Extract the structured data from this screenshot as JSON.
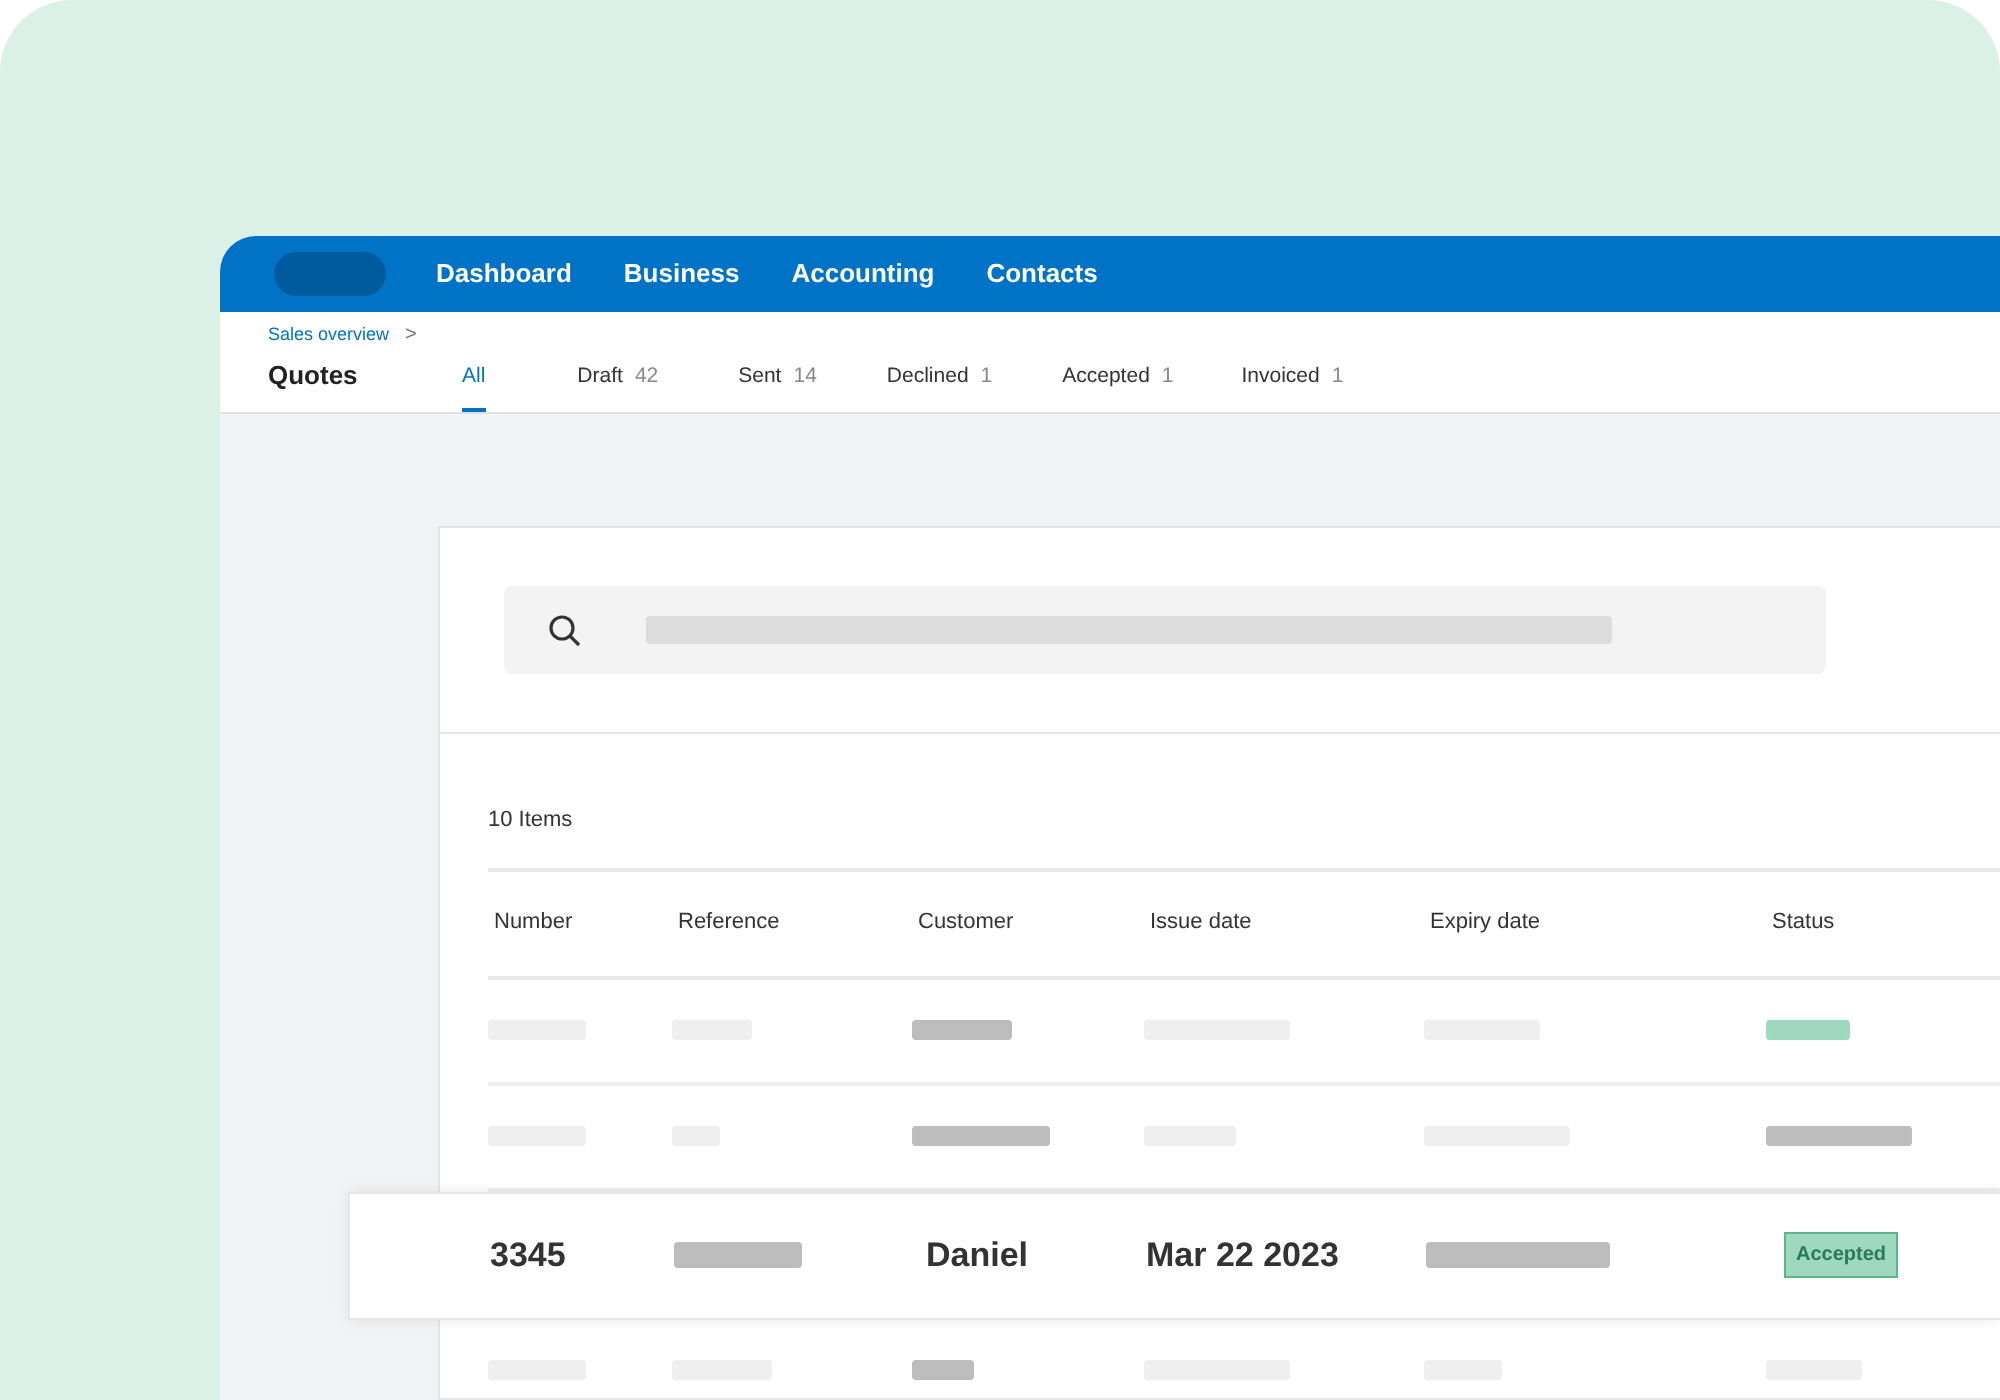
{
  "nav": {
    "items": [
      {
        "label": "Dashboard"
      },
      {
        "label": "Business"
      },
      {
        "label": "Accounting"
      },
      {
        "label": "Contacts"
      }
    ]
  },
  "header": {
    "breadcrumb": "Sales overview",
    "chevron": ">",
    "title": "Quotes"
  },
  "tabs": [
    {
      "label": "All",
      "selected": true
    },
    {
      "label": "Draft",
      "count": "42",
      "selected": false
    },
    {
      "label": "Sent",
      "count": "14",
      "selected": false
    },
    {
      "label": "Declined",
      "count": "1",
      "selected": false
    },
    {
      "label": "Accepted",
      "count": "1",
      "selected": false
    },
    {
      "label": "Invoiced",
      "count": "1",
      "selected": false
    }
  ],
  "item_count": "10 Items",
  "table": {
    "columns": [
      "Number",
      "Reference",
      "Customer",
      "Issue date",
      "Expiry date",
      "Status"
    ],
    "rows": [
      {
        "kind": "skeleton",
        "cells": [
          {
            "kind": "light"
          },
          {
            "kind": "light"
          },
          {
            "kind": "dark"
          },
          {
            "kind": "light"
          },
          {
            "kind": "light"
          },
          {
            "kind": "accent"
          }
        ]
      },
      {
        "kind": "skeleton",
        "cells": [
          {
            "kind": "light"
          },
          {
            "kind": "light"
          },
          {
            "kind": "dark"
          },
          {
            "kind": "light"
          },
          {
            "kind": "light"
          },
          {
            "kind": "dark"
          }
        ]
      },
      {
        "kind": "highlight",
        "number": "3345",
        "customer": "Daniel",
        "issue_date": "Mar 22 2023",
        "status": "Accepted"
      },
      {
        "kind": "skeleton",
        "cells": [
          {
            "kind": "light"
          },
          {
            "kind": "light"
          },
          {
            "kind": "dark"
          },
          {
            "kind": "light"
          },
          {
            "kind": "light"
          },
          {
            "kind": "light"
          }
        ]
      }
    ]
  }
}
